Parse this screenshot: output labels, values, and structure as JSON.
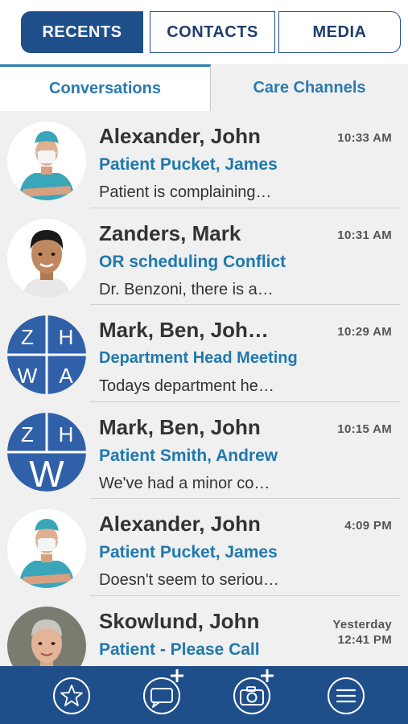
{
  "top_tabs": [
    {
      "label": "RECENTS",
      "active": true
    },
    {
      "label": "CONTACTS",
      "active": false
    },
    {
      "label": "MEDIA",
      "active": false
    }
  ],
  "sub_tabs": [
    {
      "label": "Conversations",
      "active": true
    },
    {
      "label": "Care Channels",
      "active": false
    }
  ],
  "conversations": [
    {
      "name": "Alexander, John",
      "time": "10:33 AM",
      "subject": "Patient Pucket, James",
      "preview": "Patient is complaining…",
      "avatar": "surgeon-photo"
    },
    {
      "name": "Zanders, Mark",
      "time": "10:31 AM",
      "subject": "OR scheduling Conflict",
      "preview": "Dr. Benzoni, there is a…",
      "avatar": "man-photo"
    },
    {
      "name": "Mark, Ben, Joh…",
      "time": "10:29 AM",
      "subject": "Department Head Meeting",
      "preview": "Todays department he…",
      "avatar": "group-initials",
      "initials": [
        "Z",
        "H",
        "W",
        "A"
      ]
    },
    {
      "name": "Mark, Ben, John",
      "time": "10:15 AM",
      "subject": "Patient Smith, Andrew",
      "preview": "We've had a minor co…",
      "avatar": "group-initials",
      "initials": [
        "Z",
        "H",
        "W"
      ]
    },
    {
      "name": "Alexander, John",
      "time": "4:09 PM",
      "subject": "Patient Pucket, James",
      "preview": "Doesn't seem to seriou…",
      "avatar": "surgeon-photo"
    },
    {
      "name": "Skowlund, John",
      "time_line1": "Yesterday",
      "time_line2": "12:41 PM",
      "subject": "Patient - Please Call",
      "preview": "",
      "avatar": "man-photo-2"
    }
  ],
  "toolbar": [
    {
      "icon": "star-icon"
    },
    {
      "icon": "new-message-icon"
    },
    {
      "icon": "new-photo-icon"
    },
    {
      "icon": "menu-icon"
    }
  ],
  "colors": {
    "brand_navy": "#1f4f8a",
    "accent_blue": "#1f79ad",
    "list_bg": "#f0f0f0",
    "group_avatar_blue": "#3060a8"
  }
}
